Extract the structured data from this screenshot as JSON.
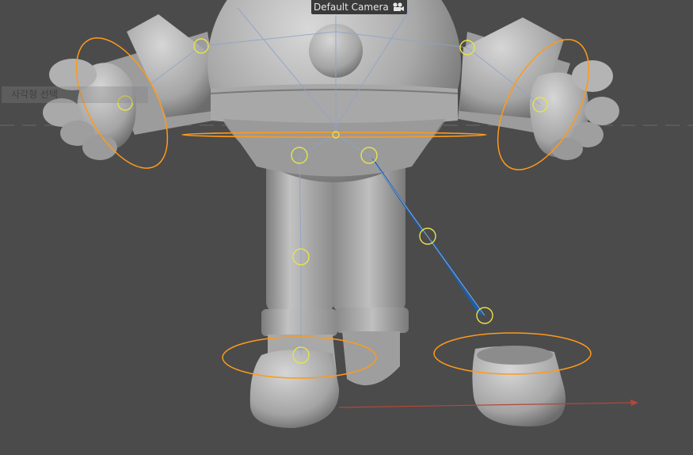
{
  "viewport": {
    "camera_label": "Default Camera",
    "camera_icon": "camera-icon",
    "ghost_label": "사각형 선택"
  },
  "colors": {
    "background": "#4b4b4b",
    "body_light": "#c9c9c9",
    "body_mid": "#9a9a9a",
    "body_dark": "#6d6d6d",
    "ik_ring": "#ff9a1a",
    "joint_circle": "#e7e34a",
    "bone_blue": "#1b5fa8",
    "bone_line": "#8fa3c9",
    "axis_red": "#b4473b",
    "horizon": "#6a6a6a"
  }
}
